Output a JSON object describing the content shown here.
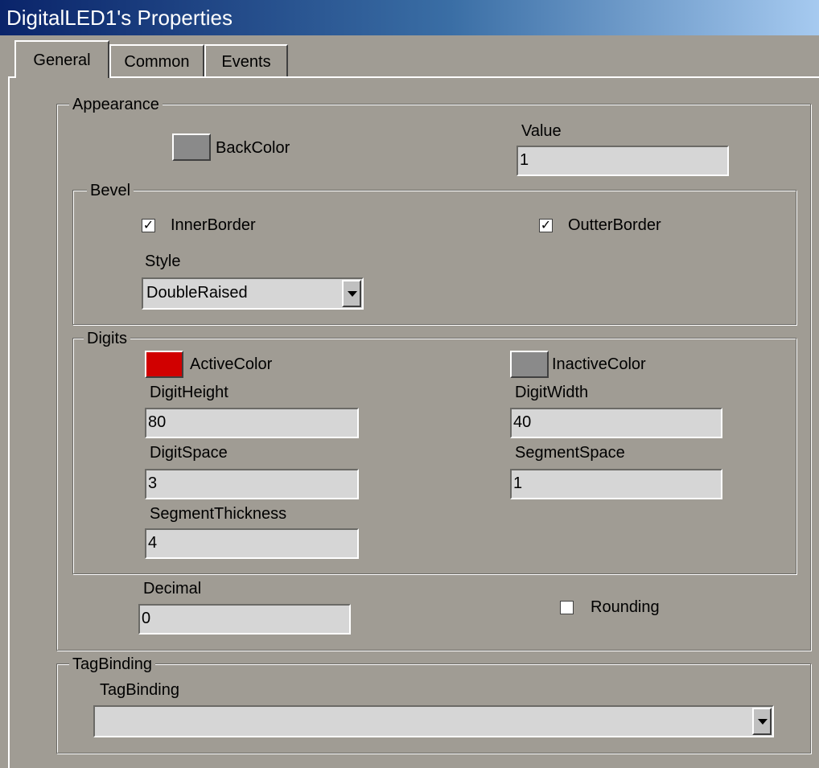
{
  "window": {
    "title": "DigitalLED1's Properties"
  },
  "tabs": [
    {
      "label": "General",
      "active": true
    },
    {
      "label": "Common",
      "active": false
    },
    {
      "label": "Events",
      "active": false
    }
  ],
  "appearance": {
    "legend": "Appearance",
    "backcolor_label": "BackColor",
    "backcolor_value": "#8a8a8a",
    "value_label": "Value",
    "value_field": "1"
  },
  "bevel": {
    "legend": "Bevel",
    "inner_border_label": "InnerBorder",
    "inner_border_checked": true,
    "outer_border_label": "OutterBorder",
    "outer_border_checked": true,
    "style_label": "Style",
    "style_value": "DoubleRaised"
  },
  "digits": {
    "legend": "Digits",
    "active_color_label": "ActiveColor",
    "active_color_value": "#d10000",
    "inactive_color_label": "InactiveColor",
    "inactive_color_value": "#8a8a8a",
    "digit_height_label": "DigitHeight",
    "digit_height_value": "80",
    "digit_width_label": "DigitWidth",
    "digit_width_value": "40",
    "digit_space_label": "DigitSpace",
    "digit_space_value": "3",
    "segment_space_label": "SegmentSpace",
    "segment_space_value": "1",
    "segment_thickness_label": "SegmentThickness",
    "segment_thickness_value": "4"
  },
  "decimal": {
    "label": "Decimal",
    "value": "0"
  },
  "rounding": {
    "label": "Rounding",
    "checked": false
  },
  "tagbinding": {
    "legend": "TagBinding",
    "label": "TagBinding",
    "value": ""
  },
  "icons": {
    "check": "checkmark-icon",
    "dropdown": "chevron-down-icon"
  }
}
